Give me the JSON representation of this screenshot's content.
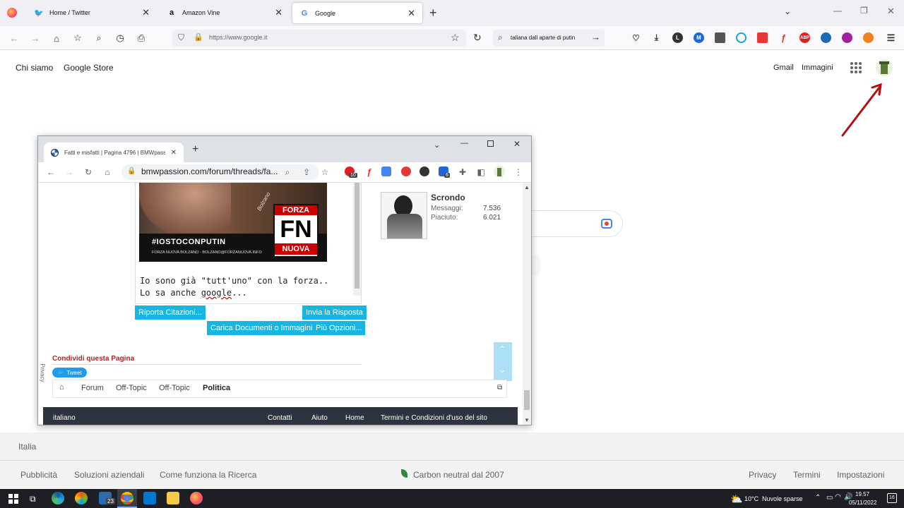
{
  "firefox": {
    "tabs": [
      {
        "label": "Home / Twitter"
      },
      {
        "label": "Amazon Vine"
      },
      {
        "label": "Google"
      }
    ],
    "url": "https://www.google.it",
    "search_value": "taliana dall aparte di  putin",
    "extension_badges": {
      "L": "L",
      "M": "M",
      "abp": "ABP"
    }
  },
  "google": {
    "header_left": [
      "Chi siamo",
      "Google Store"
    ],
    "header_right": [
      "Gmail",
      "Immagini"
    ],
    "country": "Italia",
    "footer_left": [
      "Pubblicità",
      "Soluzioni aziendali",
      "Come funziona la Ricerca"
    ],
    "footer_center": "Carbon neutral dal 2007",
    "footer_right": [
      "Privacy",
      "Termini",
      "Impostazioni"
    ]
  },
  "chrome": {
    "tab_title": "Fatti e misfatti | Pagina 4796 | BMWpassi",
    "url": "bmwpassion.com/forum/threads/fa...",
    "badge_abp": "10",
    "badge_m": "6",
    "poster_tag": "#IOSTOCONPUTIN",
    "poster_small": "FORZA NUOVA BOLZANO - BOLZANO@FORZANUOVA.INFO",
    "poster_logo_top": "FORZA",
    "poster_logo_mid": "FN",
    "poster_logo_bot": "NUOVA",
    "poster_sign": "Bolzano",
    "editor_line1": "Io sono già \"tutt'uno\" con la forza..",
    "editor_line2_a": "Lo sa anche ",
    "editor_line2_b": "google",
    "editor_line2_c": "...",
    "btn_quote": "Riporta Citazioni...",
    "btn_reply": "Invia la Risposta",
    "btn_upload": "Carica Documenti o Immagini",
    "btn_more": "Più Opzioni...",
    "user_name": "Scrondo",
    "stat1_label": "Messaggi:",
    "stat1_value": "7.536",
    "stat2_label": "Piaciuto:",
    "stat2_value": "6.021",
    "share_title": "Condividi questa Pagina",
    "tweet_label": "Tweet",
    "privacy_label": "Privacy",
    "breadcrumb": [
      "Forum",
      "Off-Topic",
      "Off-Topic",
      "Politica"
    ],
    "footer_lang": "italiano",
    "footer_links": [
      "Contatti",
      "Aiuto",
      "Home",
      "Termini e Condizioni d'uso del sito"
    ]
  },
  "taskbar": {
    "weather_temp": "10°C",
    "weather_desc": "Nuvole sparse",
    "time": "19.57",
    "date": "05/11/2022",
    "badge_23": "23",
    "notif_count": "16"
  }
}
